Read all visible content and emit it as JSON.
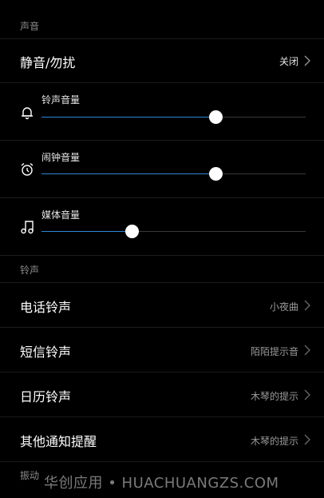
{
  "sound_section": {
    "header": "声音"
  },
  "dnd": {
    "label": "静音/勿扰",
    "value": "关闭"
  },
  "sliders": [
    {
      "label": "铃声音量",
      "icon": "bell-icon",
      "level": 0.66
    },
    {
      "label": "闹钟音量",
      "icon": "alarm-clock-icon",
      "level": 0.66
    },
    {
      "label": "媒体音量",
      "icon": "music-note-icon",
      "level": 0.34
    }
  ],
  "ringtone_section": {
    "header": "铃声"
  },
  "ringtones": [
    {
      "label": "电话铃声",
      "value": "小夜曲"
    },
    {
      "label": "短信铃声",
      "value": "陌陌提示音"
    },
    {
      "label": "日历铃声",
      "value": "木琴的提示"
    },
    {
      "label": "其他通知提醒",
      "value": "木琴的提示"
    }
  ],
  "vibration_section": {
    "header": "振动"
  },
  "watermark": "华创应用 • HUACHUANGZS.COM",
  "colors": {
    "accent": "#2f86d6",
    "background": "#000000"
  }
}
